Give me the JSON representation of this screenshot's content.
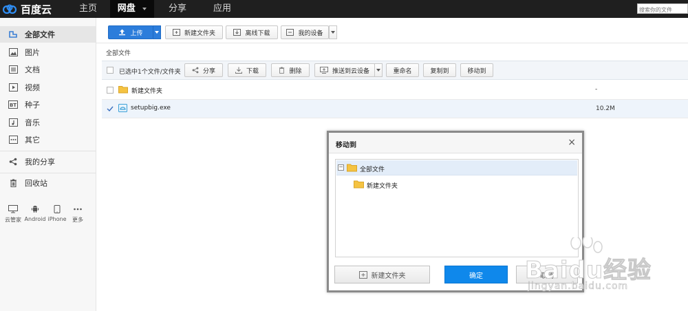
{
  "header": {
    "logo": "百度云",
    "nav": [
      "主页",
      "网盘",
      "分享",
      "应用"
    ],
    "active_nav": "网盘",
    "search_placeholder": "搜索你的文件"
  },
  "sidebar": {
    "items": [
      {
        "label": "全部文件",
        "icon": "folder-tree-icon"
      },
      {
        "label": "图片",
        "icon": "image-icon"
      },
      {
        "label": "文档",
        "icon": "document-icon"
      },
      {
        "label": "视频",
        "icon": "video-icon"
      },
      {
        "label": "种子",
        "icon": "bt-icon"
      },
      {
        "label": "音乐",
        "icon": "music-icon"
      },
      {
        "label": "其它",
        "icon": "more-icon"
      },
      {
        "label": "我的分享",
        "icon": "share-icon"
      },
      {
        "label": "回收站",
        "icon": "trash-icon"
      }
    ],
    "devices": [
      "云管家",
      "Android",
      "iPhone",
      "更多"
    ]
  },
  "toolbar": {
    "upload": "上传",
    "new_folder": "新建文件夹",
    "offline_download": "离线下载",
    "my_device": "我的设备"
  },
  "breadcrumb": "全部文件",
  "selection_bar": {
    "text": "已选中1个文件/文件夹",
    "share": "分享",
    "download": "下载",
    "delete": "删除",
    "push_cloud": "推送到云设备",
    "rename": "重命名",
    "copy_to": "复制到",
    "move_to": "移动到"
  },
  "files": [
    {
      "name": "新建文件夹",
      "size": "-",
      "checked": false
    },
    {
      "name": "setupbig.exe",
      "size": "10.2M",
      "checked": true
    }
  ],
  "dialog": {
    "title": "移动到",
    "close": "×",
    "tree_root": "全部文件",
    "tree_children": [
      "新建文件夹"
    ],
    "new_folder_button": "新建文件夹",
    "confirm_button": "确定",
    "cancel_button": "取消"
  },
  "watermark": {
    "brand": "Baidu经验",
    "url": "jingyan.baidu.com"
  },
  "colors": {
    "primary": "#2c7ddb",
    "confirm": "#0f88eb",
    "folder": "#f5c342"
  }
}
